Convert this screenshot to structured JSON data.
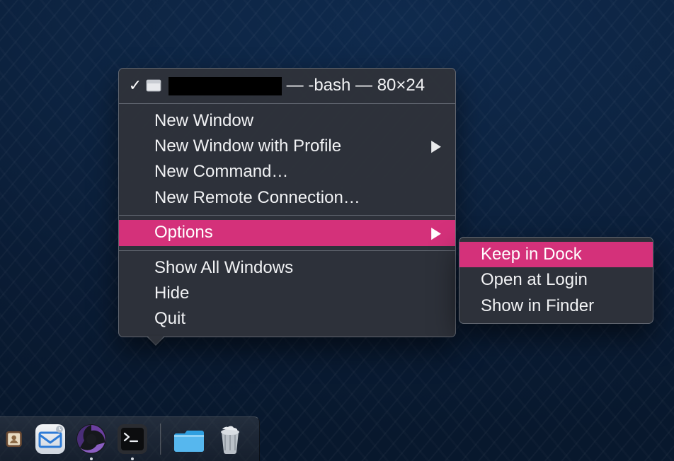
{
  "colors": {
    "menu_bg": "#2e323a",
    "menu_border": "#787e88",
    "highlight": "#d4317a",
    "wallpaper_base": "#0d2442"
  },
  "header": {
    "checkmark": "✓",
    "window_title_redacted": true,
    "window_title_suffix": " — -bash — 80×24"
  },
  "menu": {
    "items": [
      {
        "id": "new-window",
        "label": "New Window",
        "submenu": false
      },
      {
        "id": "new-window-profile",
        "label": "New Window with Profile",
        "submenu": true
      },
      {
        "id": "new-command",
        "label": "New Command…",
        "submenu": false
      },
      {
        "id": "new-remote-connection",
        "label": "New Remote Connection…",
        "submenu": false
      }
    ],
    "options_label": "Options",
    "items2": [
      {
        "id": "show-all-windows",
        "label": "Show All Windows"
      },
      {
        "id": "hide",
        "label": "Hide"
      },
      {
        "id": "quit",
        "label": "Quit"
      }
    ]
  },
  "submenu": {
    "items": [
      {
        "id": "keep-in-dock",
        "label": "Keep in Dock",
        "highlight": true
      },
      {
        "id": "open-at-login",
        "label": "Open at Login",
        "highlight": false
      },
      {
        "id": "show-in-finder",
        "label": "Show in Finder",
        "highlight": false
      }
    ]
  },
  "dock": {
    "items": [
      {
        "id": "contacts",
        "name": "contacts-app-icon",
        "running": false
      },
      {
        "id": "mail",
        "name": "mail-app-icon",
        "running": false
      },
      {
        "id": "browser",
        "name": "browser-app-icon",
        "running": true
      },
      {
        "id": "terminal",
        "name": "terminal-app-icon",
        "running": true
      }
    ],
    "right_items": [
      {
        "id": "downloads",
        "name": "downloads-folder-icon"
      },
      {
        "id": "trash",
        "name": "trash-icon"
      }
    ]
  }
}
